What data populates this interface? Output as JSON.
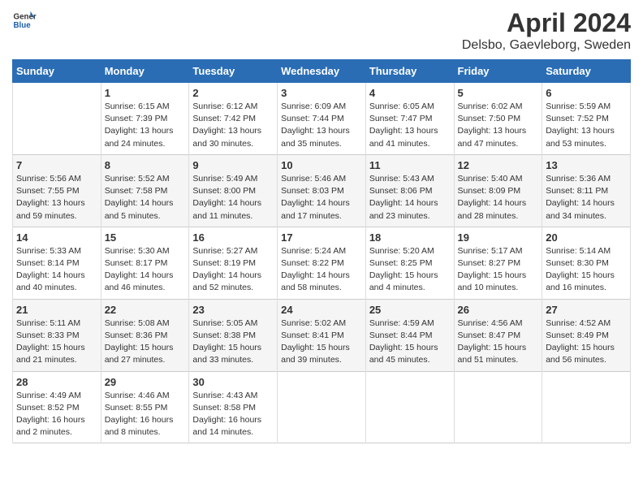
{
  "logo": {
    "line1": "General",
    "line2": "Blue"
  },
  "title": "April 2024",
  "subtitle": "Delsbo, Gaevleborg, Sweden",
  "days_of_week": [
    "Sunday",
    "Monday",
    "Tuesday",
    "Wednesday",
    "Thursday",
    "Friday",
    "Saturday"
  ],
  "weeks": [
    [
      {
        "day": "",
        "info": ""
      },
      {
        "day": "1",
        "info": "Sunrise: 6:15 AM\nSunset: 7:39 PM\nDaylight: 13 hours\nand 24 minutes."
      },
      {
        "day": "2",
        "info": "Sunrise: 6:12 AM\nSunset: 7:42 PM\nDaylight: 13 hours\nand 30 minutes."
      },
      {
        "day": "3",
        "info": "Sunrise: 6:09 AM\nSunset: 7:44 PM\nDaylight: 13 hours\nand 35 minutes."
      },
      {
        "day": "4",
        "info": "Sunrise: 6:05 AM\nSunset: 7:47 PM\nDaylight: 13 hours\nand 41 minutes."
      },
      {
        "day": "5",
        "info": "Sunrise: 6:02 AM\nSunset: 7:50 PM\nDaylight: 13 hours\nand 47 minutes."
      },
      {
        "day": "6",
        "info": "Sunrise: 5:59 AM\nSunset: 7:52 PM\nDaylight: 13 hours\nand 53 minutes."
      }
    ],
    [
      {
        "day": "7",
        "info": "Sunrise: 5:56 AM\nSunset: 7:55 PM\nDaylight: 13 hours\nand 59 minutes."
      },
      {
        "day": "8",
        "info": "Sunrise: 5:52 AM\nSunset: 7:58 PM\nDaylight: 14 hours\nand 5 minutes."
      },
      {
        "day": "9",
        "info": "Sunrise: 5:49 AM\nSunset: 8:00 PM\nDaylight: 14 hours\nand 11 minutes."
      },
      {
        "day": "10",
        "info": "Sunrise: 5:46 AM\nSunset: 8:03 PM\nDaylight: 14 hours\nand 17 minutes."
      },
      {
        "day": "11",
        "info": "Sunrise: 5:43 AM\nSunset: 8:06 PM\nDaylight: 14 hours\nand 23 minutes."
      },
      {
        "day": "12",
        "info": "Sunrise: 5:40 AM\nSunset: 8:09 PM\nDaylight: 14 hours\nand 28 minutes."
      },
      {
        "day": "13",
        "info": "Sunrise: 5:36 AM\nSunset: 8:11 PM\nDaylight: 14 hours\nand 34 minutes."
      }
    ],
    [
      {
        "day": "14",
        "info": "Sunrise: 5:33 AM\nSunset: 8:14 PM\nDaylight: 14 hours\nand 40 minutes."
      },
      {
        "day": "15",
        "info": "Sunrise: 5:30 AM\nSunset: 8:17 PM\nDaylight: 14 hours\nand 46 minutes."
      },
      {
        "day": "16",
        "info": "Sunrise: 5:27 AM\nSunset: 8:19 PM\nDaylight: 14 hours\nand 52 minutes."
      },
      {
        "day": "17",
        "info": "Sunrise: 5:24 AM\nSunset: 8:22 PM\nDaylight: 14 hours\nand 58 minutes."
      },
      {
        "day": "18",
        "info": "Sunrise: 5:20 AM\nSunset: 8:25 PM\nDaylight: 15 hours\nand 4 minutes."
      },
      {
        "day": "19",
        "info": "Sunrise: 5:17 AM\nSunset: 8:27 PM\nDaylight: 15 hours\nand 10 minutes."
      },
      {
        "day": "20",
        "info": "Sunrise: 5:14 AM\nSunset: 8:30 PM\nDaylight: 15 hours\nand 16 minutes."
      }
    ],
    [
      {
        "day": "21",
        "info": "Sunrise: 5:11 AM\nSunset: 8:33 PM\nDaylight: 15 hours\nand 21 minutes."
      },
      {
        "day": "22",
        "info": "Sunrise: 5:08 AM\nSunset: 8:36 PM\nDaylight: 15 hours\nand 27 minutes."
      },
      {
        "day": "23",
        "info": "Sunrise: 5:05 AM\nSunset: 8:38 PM\nDaylight: 15 hours\nand 33 minutes."
      },
      {
        "day": "24",
        "info": "Sunrise: 5:02 AM\nSunset: 8:41 PM\nDaylight: 15 hours\nand 39 minutes."
      },
      {
        "day": "25",
        "info": "Sunrise: 4:59 AM\nSunset: 8:44 PM\nDaylight: 15 hours\nand 45 minutes."
      },
      {
        "day": "26",
        "info": "Sunrise: 4:56 AM\nSunset: 8:47 PM\nDaylight: 15 hours\nand 51 minutes."
      },
      {
        "day": "27",
        "info": "Sunrise: 4:52 AM\nSunset: 8:49 PM\nDaylight: 15 hours\nand 56 minutes."
      }
    ],
    [
      {
        "day": "28",
        "info": "Sunrise: 4:49 AM\nSunset: 8:52 PM\nDaylight: 16 hours\nand 2 minutes."
      },
      {
        "day": "29",
        "info": "Sunrise: 4:46 AM\nSunset: 8:55 PM\nDaylight: 16 hours\nand 8 minutes."
      },
      {
        "day": "30",
        "info": "Sunrise: 4:43 AM\nSunset: 8:58 PM\nDaylight: 16 hours\nand 14 minutes."
      },
      {
        "day": "",
        "info": ""
      },
      {
        "day": "",
        "info": ""
      },
      {
        "day": "",
        "info": ""
      },
      {
        "day": "",
        "info": ""
      }
    ]
  ]
}
